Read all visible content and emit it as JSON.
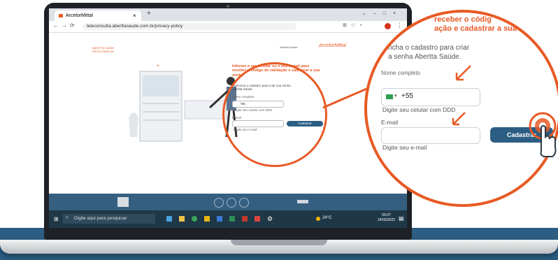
{
  "browser": {
    "tab_title": "ArcelorMittal",
    "url": "teleconsulta.aberttasaude.com.br/privacy-policy"
  },
  "header": {
    "left_brand_line1": "ABERTTA SAÚDE",
    "left_brand_line2": "ARCELORMITTAL",
    "right_brand_small": "Abertta Saúde",
    "right_brand": "ArcelorMittal"
  },
  "form": {
    "heading": "Informe o seu celular ou o seu e-mail para receber o código de validação e cadastrar a sua senha",
    "intro": "Preencha o cadastro para criar sua senha Abertta Saúde.",
    "name_label": "Nome completo",
    "phone_prefix": "+55",
    "phone_hint": "Digite seu celular com DDD",
    "email_label": "E-mail",
    "email_hint": "Digite seu e-mail",
    "submit_label": "Cadastrar"
  },
  "zoom": {
    "heading_l1": "receber o códig",
    "heading_l2": "ação e cadastrar a sua senha",
    "intro_l1": "ncha o cadastro para criar",
    "intro_l2": "a senha Abertta Saúde.",
    "name_label": "Nome completo",
    "phone_prefix": "+55",
    "phone_hint": "Digite seu celular com DDD",
    "email_label": "E-mail",
    "email_hint": "Digite seu e-mail",
    "submit_label": "Cadastrar"
  },
  "taskbar": {
    "search_placeholder": "Digite aqui para pesquisar",
    "weather": "24°C",
    "time": "09:07",
    "date": "24/02/2022"
  },
  "colors": {
    "accent": "#e85a25",
    "brand_blue": "#2c5e84"
  }
}
